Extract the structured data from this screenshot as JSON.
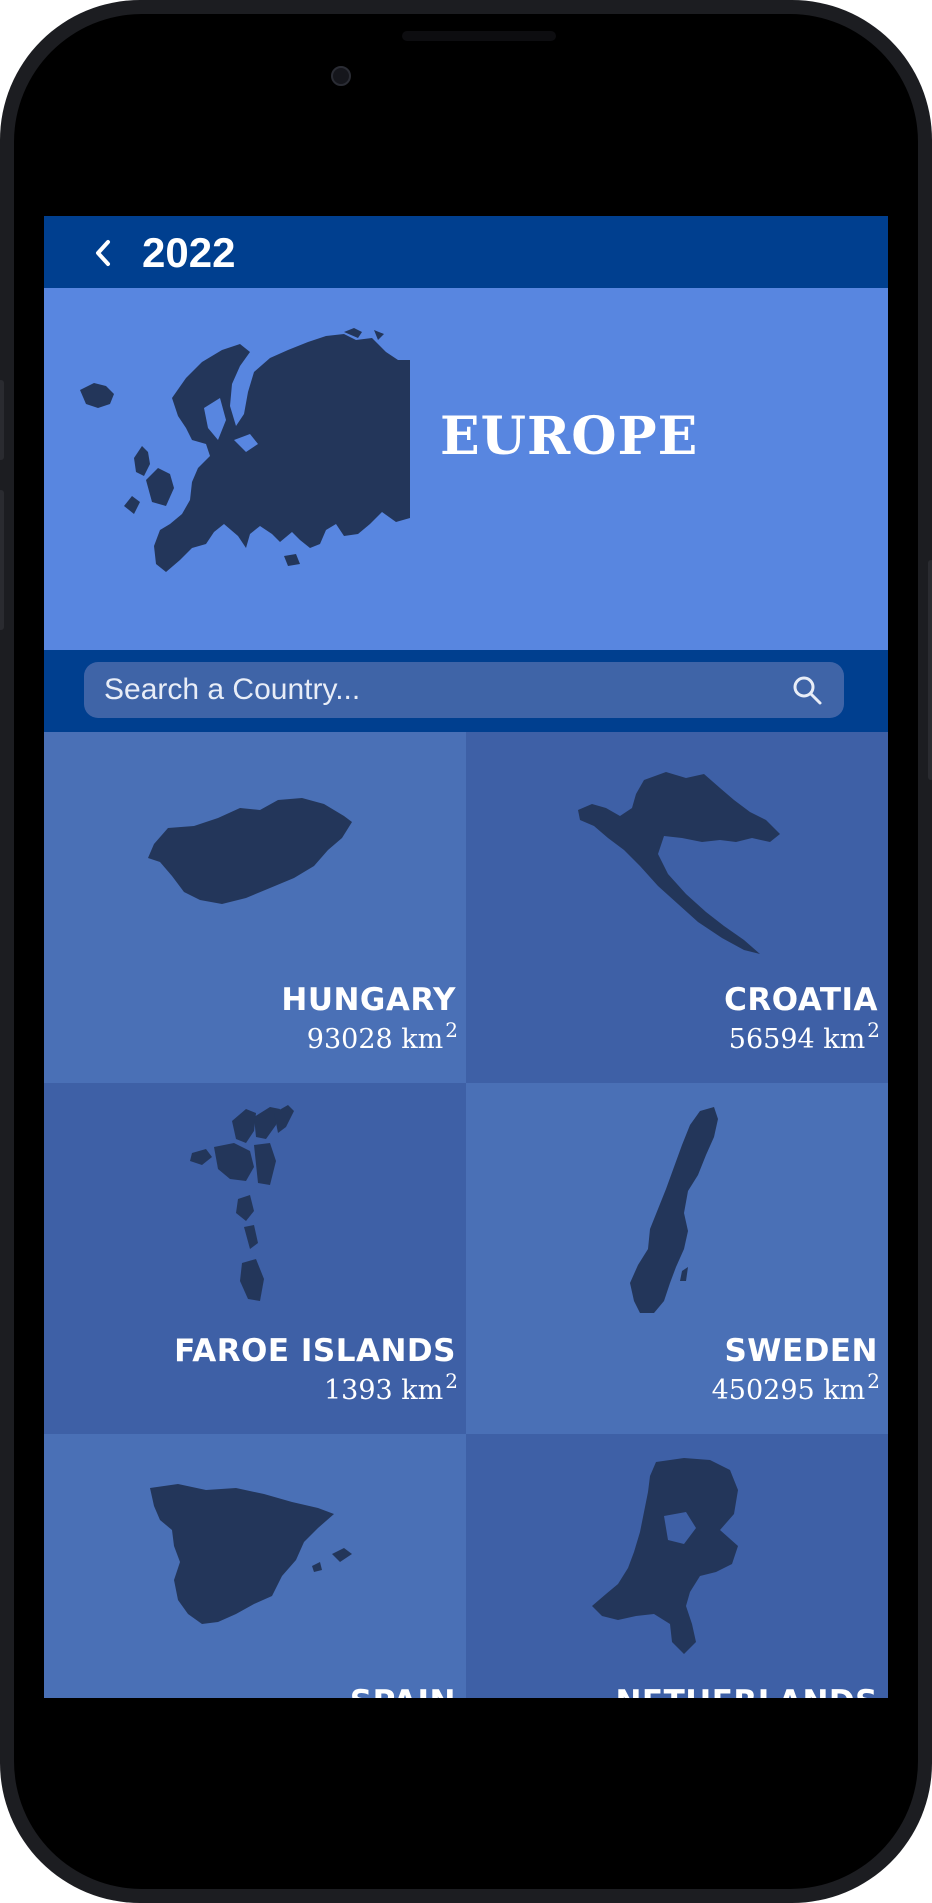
{
  "header": {
    "year": "2022",
    "back_icon": "chevron-left-icon"
  },
  "hero": {
    "region": "EUROPE"
  },
  "search": {
    "placeholder": "Search a Country...",
    "icon": "search-icon"
  },
  "countries": [
    {
      "name": "HUNGARY",
      "area": "93028",
      "unit": "km",
      "exp": "2"
    },
    {
      "name": "CROATIA",
      "area": "56594",
      "unit": "km",
      "exp": "2"
    },
    {
      "name": "FAROE ISLANDS",
      "area": "1393",
      "unit": "km",
      "exp": "2"
    },
    {
      "name": "SWEDEN",
      "area": "450295",
      "unit": "km",
      "exp": "2"
    },
    {
      "name": "SPAIN",
      "area": "",
      "unit": "",
      "exp": ""
    },
    {
      "name": "NETHERLANDS",
      "area": "",
      "unit": "",
      "exp": ""
    }
  ],
  "colors": {
    "topbar": "#003f8f",
    "hero": "#5886e0",
    "search_field": "#3f64a7",
    "tile_a": "#4a70b6",
    "tile_b": "#3e60a6",
    "map_fill": "#23365a"
  }
}
